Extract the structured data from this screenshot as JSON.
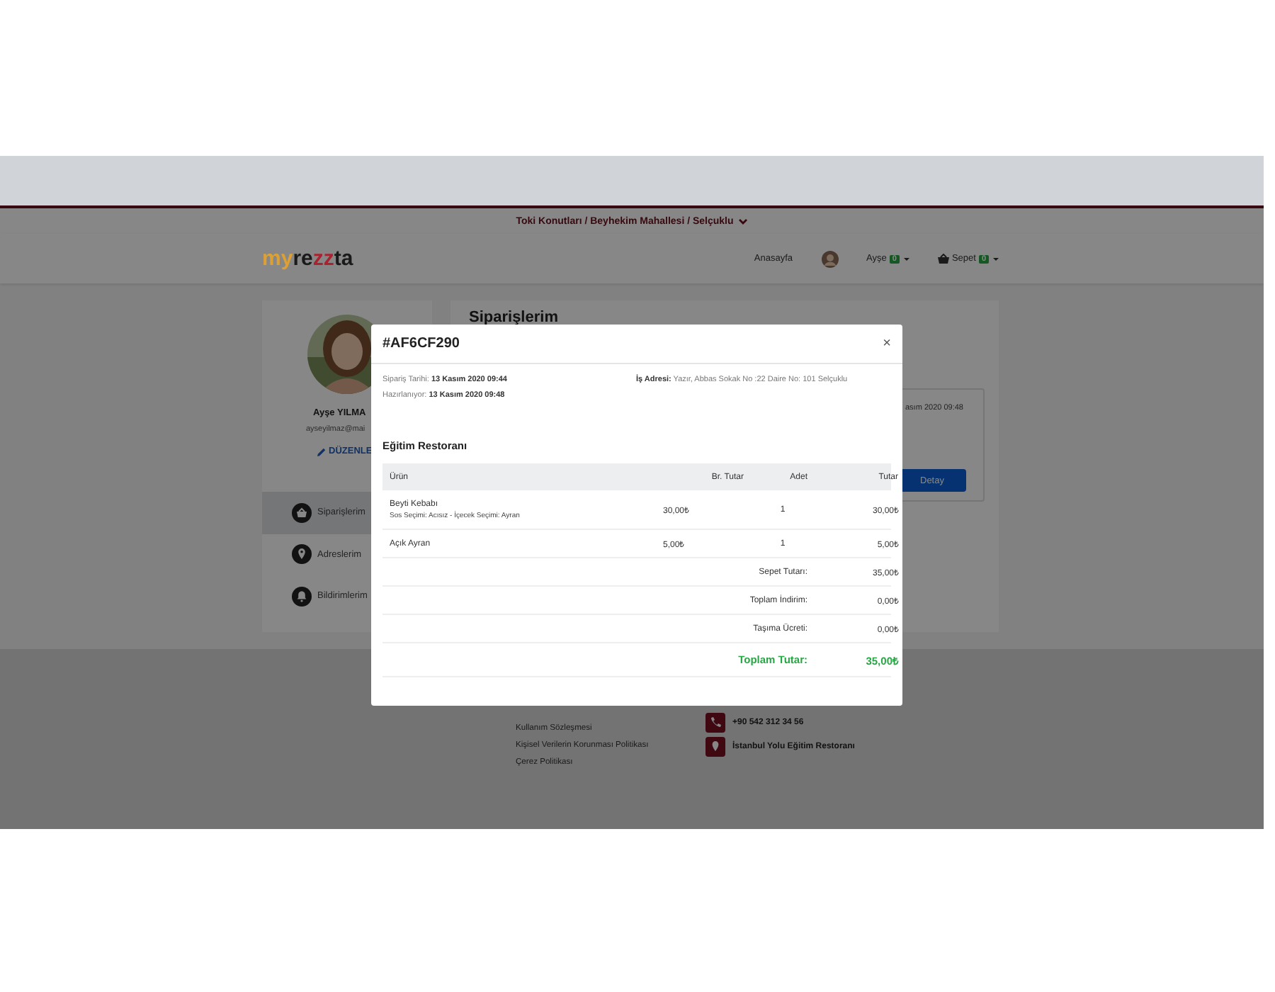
{
  "location_bar": {
    "text": "Toki Konutları / Beyhekim Mahallesi / Selçuklu"
  },
  "header": {
    "logo": [
      {
        "text": "my",
        "color": "#dda034"
      },
      {
        "text": "re",
        "color": "#1a1a1a"
      },
      {
        "text": "zz",
        "color": "#a8222f"
      },
      {
        "text": "ta",
        "color": "#1a1a1a"
      }
    ],
    "nav": [
      {
        "kind": "link",
        "label": "Anasayfa"
      },
      {
        "kind": "user",
        "label": "Ayşe",
        "badge": "0"
      },
      {
        "kind": "cart",
        "label": "Sepet",
        "badge": "0"
      }
    ]
  },
  "profile": {
    "name": "Ayşe YILMA",
    "email": "ayseyilmaz@mai",
    "edit_label": "DÜZENLE",
    "menu": [
      {
        "kind": "orders",
        "label": "Siparişlerim",
        "selected": true
      },
      {
        "kind": "addresses",
        "label": "Adreslerim",
        "selected": false
      },
      {
        "kind": "notifications",
        "label": "Bildirimlerim",
        "selected": false
      }
    ]
  },
  "orders": {
    "title": "Siparişlerim",
    "order_date_fragment": "asım 2020 09:48",
    "detail_button": "Detay"
  },
  "modal": {
    "title": "#AF6CF290",
    "close": "×",
    "order_date_label": "Sipariş Tarihi:",
    "order_date": "13 Kasım 2020 09:44",
    "status_label": "Hazırlanıyor:",
    "status_date": "13 Kasım 2020 09:48",
    "address_label": "İş Adresi:",
    "address": "Yazır, Abbas Sokak No :22 Daire No: 101 Selçuklu",
    "restaurant": "Eğitim Restoranı",
    "columns": [
      "Ürün",
      "Br. Tutar",
      "Adet",
      "Tutar"
    ],
    "items": [
      {
        "name": "Beyti Kebabı",
        "options": "Sos Seçimi: Acısız - İçecek Seçimi: Ayran",
        "unit_price": "30,00₺",
        "quantity": "1",
        "total": "30,00₺"
      },
      {
        "name": "Açık Ayran",
        "unit_price": "5,00₺",
        "quantity": "1",
        "total": "5,00₺"
      }
    ],
    "summary": [
      {
        "kind": "normal",
        "label": "Sepet Tutarı:",
        "value": "35,00₺"
      },
      {
        "kind": "normal",
        "label": "Toplam İndirim:",
        "value": "0,00₺"
      },
      {
        "kind": "normal",
        "label": "Taşıma Ücreti:",
        "value": "0,00₺"
      },
      {
        "kind": "total",
        "label": "Toplam Tutar:",
        "value": "35,00₺"
      }
    ]
  },
  "footer": {
    "links": [
      "Kullanım Sözleşmesi",
      "Kişisel Verilerin Korunması Politikası",
      "Çerez Politikası"
    ],
    "contacts": [
      {
        "kind": "phone",
        "text": "+90 542 312 34 56"
      },
      {
        "kind": "location",
        "text": "İstanbul Yolu Eğitim Restoranı"
      }
    ]
  }
}
